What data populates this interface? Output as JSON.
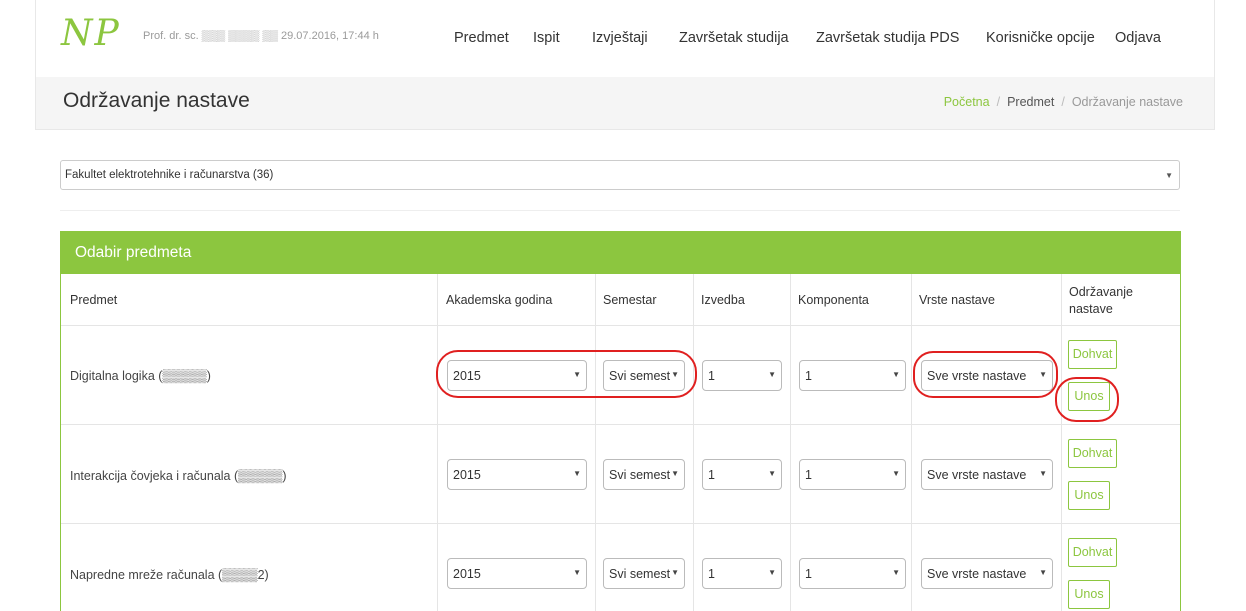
{
  "header": {
    "logo": "NP",
    "user_info": "Prof. dr. sc. ▒▒▒ ▒▒▒▒ ▒▒ 29.07.2016, 17:44 h",
    "nav": [
      "Predmet",
      "Ispit",
      "Izvještaji",
      "Završetak studija",
      "Završetak studija PDS",
      "Korisničke opcije",
      "Odjava"
    ]
  },
  "page": {
    "title": "Održavanje nastave",
    "breadcrumb": [
      "Početna",
      "Predmet",
      "Održavanje nastave"
    ]
  },
  "faculty_select": {
    "value": "Fakultet elektrotehnike i računarstva (36)"
  },
  "panel": {
    "title": "Odabir predmeta",
    "columns": [
      "Predmet",
      "Akademska godina",
      "Semestar",
      "Izvedba",
      "Komponenta",
      "Vrste nastave",
      "Održavanje nastave"
    ],
    "rows": [
      {
        "subject": "Digitalna logika (▒▒▒▒▒)",
        "year": "2015",
        "semester": "Svi semest",
        "izvedba": "1",
        "komponenta": "1",
        "vrste": "Sve vrste nastave",
        "btn_fetch": "Dohvat",
        "btn_entry": "Unos"
      },
      {
        "subject": "Interakcija čovjeka i računala (▒▒▒▒▒)",
        "year": "2015",
        "semester": "Svi semest",
        "izvedba": "1",
        "komponenta": "1",
        "vrste": "Sve vrste nastave",
        "btn_fetch": "Dohvat",
        "btn_entry": "Unos"
      },
      {
        "subject": "Napredne mreže računala (▒▒▒▒2)",
        "year": "2015",
        "semester": "Svi semest",
        "izvedba": "1",
        "komponenta": "1",
        "vrste": "Sve vrste nastave",
        "btn_fetch": "Dohvat",
        "btn_entry": "Unos"
      }
    ]
  },
  "colors": {
    "accent": "#8cc63f",
    "annotation": "#e02020"
  },
  "icons": {
    "caret": "▼"
  }
}
